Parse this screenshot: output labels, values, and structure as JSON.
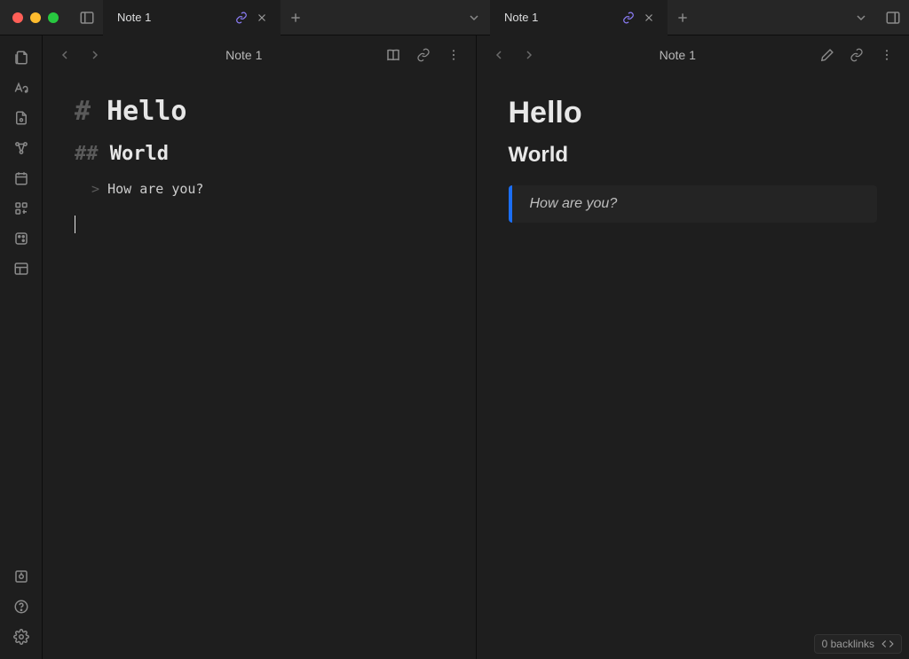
{
  "tabs": {
    "left": {
      "title": "Note 1"
    },
    "right": {
      "title": "Note 1"
    }
  },
  "panes": {
    "left": {
      "title": "Note 1",
      "h1_marker": "#",
      "h1_text": "Hello",
      "h2_marker": "##",
      "h2_text": "World",
      "quote_marker": ">",
      "quote_text": "How are you?"
    },
    "right": {
      "title": "Note 1",
      "h1": "Hello",
      "h2": "World",
      "quote": "How are you?"
    }
  },
  "status": {
    "backlinks": "0 backlinks"
  }
}
